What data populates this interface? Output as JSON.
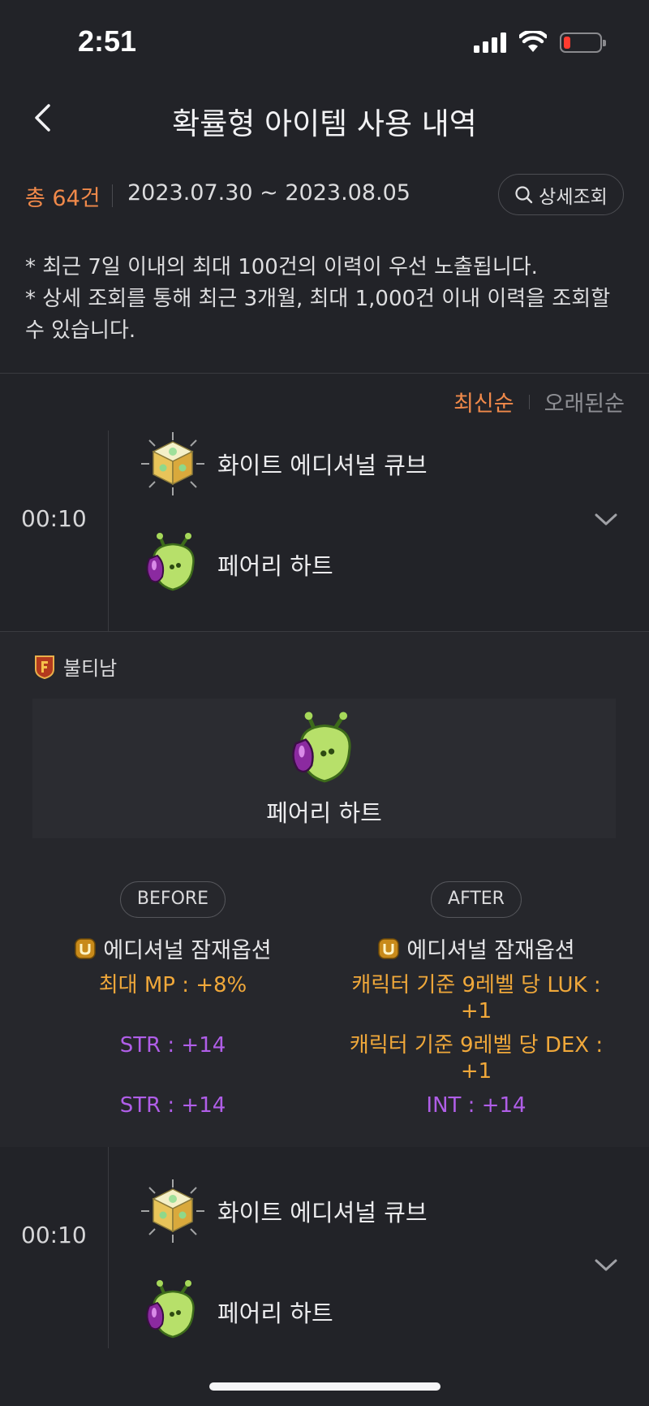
{
  "status": {
    "time": "2:51"
  },
  "header": {
    "title": "확률형 아이템 사용 내역"
  },
  "summary": {
    "total": "총 64건",
    "date_range": "2023.07.30 ~ 2023.08.05",
    "detail_button": "상세조회"
  },
  "notice": {
    "line1": "* 최근 7일 이내의 최대 100건의 이력이 우선 노출됩니다.",
    "line2": "* 상세 조회를 통해 최근 3개월, 최대 1,000건 이내 이력을 조회할 수 있습니다."
  },
  "sort": {
    "newest": "최신순",
    "oldest": "오래된순"
  },
  "entries": [
    {
      "time": "00:10",
      "used_item": "화이트 에디셔널 큐브",
      "target_item": "페어리 하트"
    },
    {
      "time": "00:10",
      "used_item": "화이트 에디셔널 큐브",
      "target_item": "페어리 하트"
    }
  ],
  "detail": {
    "character": "불티남",
    "item_name": "페어리 하트",
    "before": {
      "label": "BEFORE",
      "option_title": "에디셔널 잠재옵션",
      "lines": [
        "최대 MP : +8%",
        "STR : +14",
        "STR : +14"
      ]
    },
    "after": {
      "label": "AFTER",
      "option_title": "에디셔널 잠재옵션",
      "lines": [
        "캐릭터 기준 9레벨 당 LUK : +1",
        "캐릭터 기준 9레벨 당 DEX : +1",
        "INT : +14"
      ]
    }
  },
  "colors": {
    "accent_orange": "#f0894a",
    "unique_gold": "#f0a83a",
    "epic_purple": "#b05ee8",
    "background": "#222328"
  },
  "icons": [
    "back-arrow-icon",
    "search-icon",
    "chevron-down-icon",
    "white-additional-cube-icon",
    "fairy-heart-icon",
    "guild-emblem-icon",
    "unique-grade-icon"
  ]
}
